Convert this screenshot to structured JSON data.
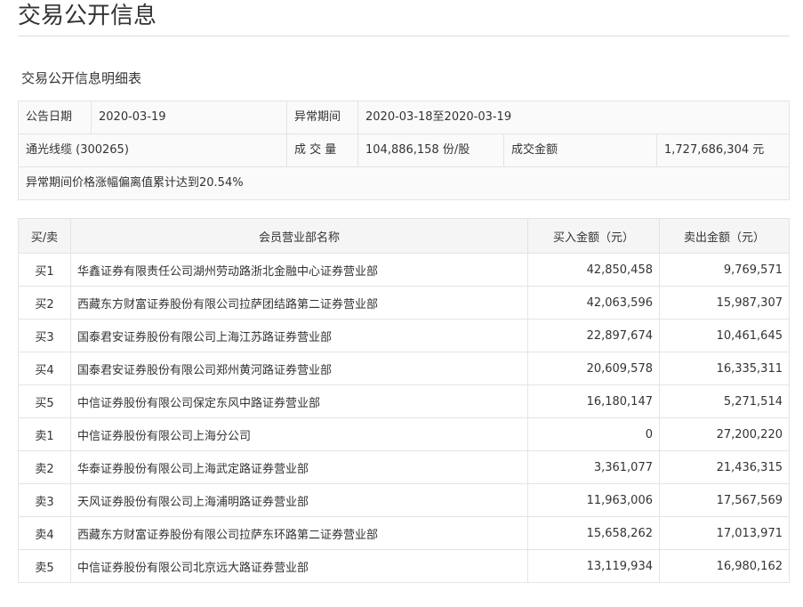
{
  "header": {
    "title": "交易公开信息"
  },
  "section": {
    "title": "交易公开信息明细表"
  },
  "info": {
    "announce_date_label": "公告日期",
    "announce_date": "2020-03-19",
    "abnormal_period_label": "异常期间",
    "abnormal_period": "2020-03-18至2020-03-19",
    "stock": "通光线缆 (300265)",
    "volume_label": "成 交 量",
    "volume": "104,886,158 份/股",
    "amount_label": "成交金额",
    "amount": "1,727,686,304 元",
    "reason": "异常期间价格涨幅偏离值累计达到20.54%"
  },
  "detail": {
    "headers": [
      "买/卖",
      "会员营业部名称",
      "买入金额（元）",
      "卖出金额（元）"
    ],
    "rows": [
      {
        "side": "买1",
        "name": "华鑫证券有限责任公司湖州劳动路浙北金融中心证券营业部",
        "buy": "42,850,458",
        "sell": "9,769,571"
      },
      {
        "side": "买2",
        "name": "西藏东方财富证券股份有限公司拉萨团结路第二证券营业部",
        "buy": "42,063,596",
        "sell": "15,987,307"
      },
      {
        "side": "买3",
        "name": "国泰君安证券股份有限公司上海江苏路证券营业部",
        "buy": "22,897,674",
        "sell": "10,461,645"
      },
      {
        "side": "买4",
        "name": "国泰君安证券股份有限公司郑州黄河路证券营业部",
        "buy": "20,609,578",
        "sell": "16,335,311"
      },
      {
        "side": "买5",
        "name": "中信证券股份有限公司保定东风中路证券营业部",
        "buy": "16,180,147",
        "sell": "5,271,514"
      },
      {
        "side": "卖1",
        "name": "中信证券股份有限公司上海分公司",
        "buy": "0",
        "sell": "27,200,220"
      },
      {
        "side": "卖2",
        "name": "华泰证券股份有限公司上海武定路证券营业部",
        "buy": "3,361,077",
        "sell": "21,436,315"
      },
      {
        "side": "卖3",
        "name": "天风证券股份有限公司上海浦明路证券营业部",
        "buy": "11,963,006",
        "sell": "17,567,569"
      },
      {
        "side": "卖4",
        "name": "西藏东方财富证券股份有限公司拉萨东环路第二证券营业部",
        "buy": "15,658,262",
        "sell": "17,013,971"
      },
      {
        "side": "卖5",
        "name": "中信证券股份有限公司北京远大路证券营业部",
        "buy": "13,119,934",
        "sell": "16,980,162"
      }
    ]
  }
}
